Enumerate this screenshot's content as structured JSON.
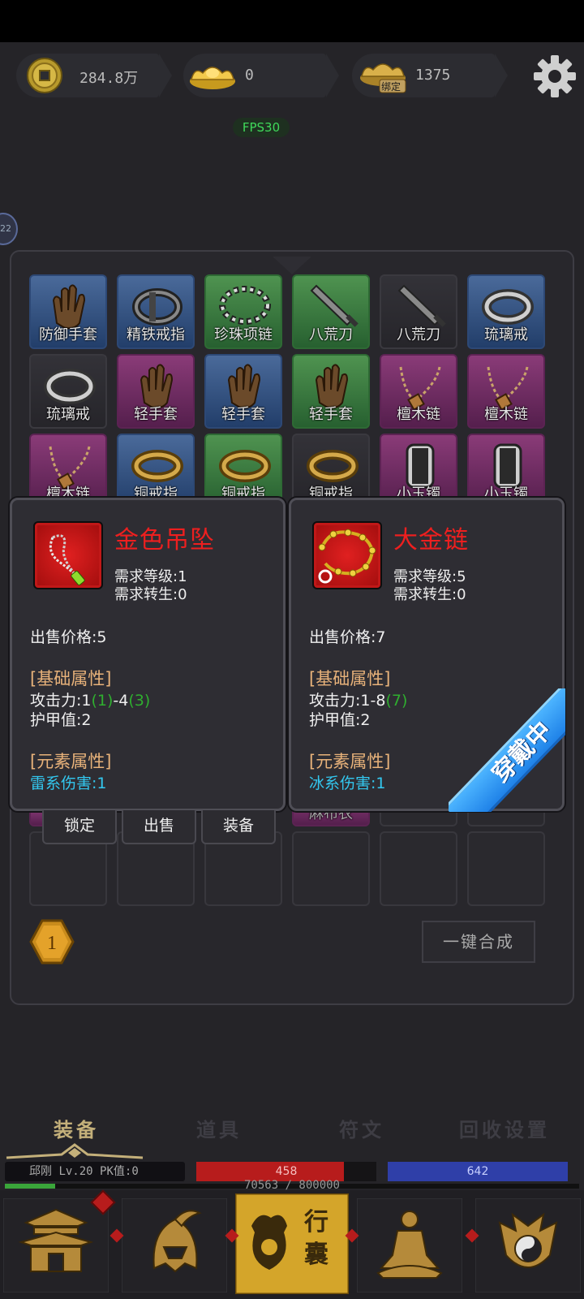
{
  "currency": {
    "coins": "284.8万",
    "ingot": "0",
    "bound_ingot": "1375",
    "bound_label": "绑定"
  },
  "fps": "FPS30",
  "side_level": "22",
  "grid": {
    "rows": [
      [
        {
          "name": "防御手套",
          "rarity": "blue",
          "icon": "glove-icon"
        },
        {
          "name": "精铁戒指",
          "rarity": "blue",
          "icon": "iron-ring-icon"
        },
        {
          "name": "珍珠项链",
          "rarity": "green",
          "icon": "pearl-necklace-icon"
        },
        {
          "name": "八荒刀",
          "rarity": "green",
          "icon": "sword-icon"
        },
        {
          "name": "八荒刀",
          "rarity": "gray",
          "icon": "sword-icon"
        },
        {
          "name": "琉璃戒",
          "rarity": "blue",
          "icon": "glass-ring-icon"
        }
      ],
      [
        {
          "name": "琉璃戒",
          "rarity": "gray",
          "icon": "glass-ring-icon"
        },
        {
          "name": "轻手套",
          "rarity": "purple",
          "icon": "glove-icon"
        },
        {
          "name": "轻手套",
          "rarity": "blue",
          "icon": "glove-icon"
        },
        {
          "name": "轻手套",
          "rarity": "green",
          "icon": "glove-icon"
        },
        {
          "name": "檀木链",
          "rarity": "purple",
          "icon": "wood-necklace-icon"
        },
        {
          "name": "檀木链",
          "rarity": "purple",
          "icon": "wood-necklace-icon"
        }
      ],
      [
        {
          "name": "檀木链",
          "rarity": "purple",
          "icon": "wood-necklace-icon"
        },
        {
          "name": "铜戒指",
          "rarity": "blue",
          "icon": "bronze-ring-icon"
        },
        {
          "name": "铜戒指",
          "rarity": "green",
          "icon": "bronze-ring-icon"
        },
        {
          "name": "铜戒指",
          "rarity": "gray",
          "icon": "bronze-ring-icon"
        },
        {
          "name": "小玉镯",
          "rarity": "purple",
          "icon": "bracelet-icon"
        },
        {
          "name": "小玉镯",
          "rarity": "purple",
          "icon": "bracelet-icon"
        }
      ]
    ],
    "partial_item": "麻布衣"
  },
  "tooltip_left": {
    "title": "金色吊坠",
    "req_level": "需求等级:1",
    "req_rebirth": "需求转生:0",
    "price": "出售价格:5",
    "basic_header": "[基础属性]",
    "atk_prefix": "攻击力:1",
    "atk_b1": "(1)",
    "atk_mid": "-4",
    "atk_b2": "(3)",
    "armor": "护甲值:2",
    "element_header": "[元素属性]",
    "element": "雷系伤害:1",
    "icon": "gold-pendant-icon"
  },
  "tooltip_right": {
    "title": "大金链",
    "req_level": "需求等级:5",
    "req_rebirth": "需求转生:0",
    "price": "出售价格:7",
    "basic_header": "[基础属性]",
    "atk_prefix": "攻击力:1-8",
    "atk_b1": "(7)",
    "armor": "护甲值:2",
    "element_header": "[元素属性]",
    "element": "冰系伤害:1",
    "badge": "穿戴中",
    "icon": "gold-chain-icon"
  },
  "actions": {
    "lock": "锁定",
    "sell": "出售",
    "equip": "装备"
  },
  "merge_button": "一键合成",
  "page_counter": "1",
  "tabs": [
    "装备",
    "道具",
    "符文",
    "回收设置"
  ],
  "active_tab": 0,
  "player": {
    "name": "邱刚",
    "level": "Lv.20",
    "pk": "PK值:0",
    "hp": "458",
    "mp": "642",
    "exp": "70563 / 800000",
    "hp_fill": 0.82,
    "exp_fill": 0.088
  },
  "nav": [
    {
      "label": "",
      "icon": "palace-icon"
    },
    {
      "label": "",
      "icon": "helmet-icon"
    },
    {
      "label": "行囊",
      "icon": "bag-icon"
    },
    {
      "label": "",
      "icon": "meditation-icon"
    },
    {
      "label": "",
      "icon": "taiji-icon"
    }
  ],
  "colors": {
    "accent_gold": "#c4b07a",
    "title_red": "#ee1f1f",
    "element_cyan": "#33c8f0",
    "hp_red": "#b71c1c",
    "mp_blue": "#2f3fa8",
    "badge_blue": "#1f82e8"
  }
}
